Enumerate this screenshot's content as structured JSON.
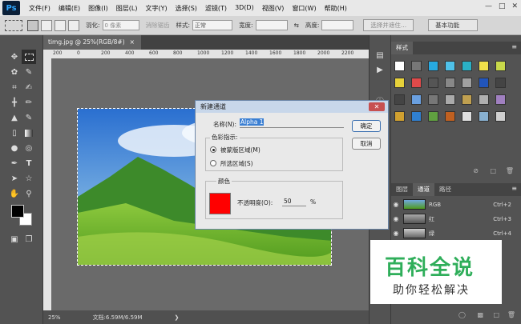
{
  "app": {
    "logo": "Ps"
  },
  "menu": [
    "文件(F)",
    "编辑(E)",
    "图像(I)",
    "图层(L)",
    "文字(Y)",
    "选择(S)",
    "滤镜(T)",
    "3D(D)",
    "视图(V)",
    "窗口(W)",
    "帮助(H)"
  ],
  "options": {
    "feather_label": "羽化:",
    "feather_value": "0 像素",
    "antialias_label": "消除锯齿",
    "style_label": "样式:",
    "style_value": "正常",
    "width_label": "宽度:",
    "height_label": "高度:",
    "select_mask_button": "选择并遮住...",
    "workspace": "基本功能"
  },
  "document": {
    "tab_title": "timg.jpg @ 25%(RGB/8#)",
    "zoom": "25%",
    "doc_size": "文档:6.59M/6.59M"
  },
  "ruler_ticks": [
    "200",
    "0",
    "200",
    "400",
    "600",
    "800",
    "1000",
    "1200",
    "1400",
    "1600",
    "1800",
    "2000",
    "2200"
  ],
  "panels": {
    "styles_tab": "样式",
    "layers_tab": "图层",
    "channels_tab": "通道",
    "paths_tab": "路径",
    "channels": [
      {
        "name": "RGB",
        "shortcut": "Ctrl+2"
      },
      {
        "name": "红",
        "shortcut": "Ctrl+3"
      },
      {
        "name": "绿",
        "shortcut": "Ctrl+4"
      }
    ]
  },
  "dialog": {
    "title": "新建通道",
    "name_label": "名称(N):",
    "name_value": "Alpha 1",
    "color_indicates_label": "色彩指示:",
    "masked_areas": "被蒙版区域(M)",
    "selected_areas": "所选区域(S)",
    "color_group_label": "颜色",
    "opacity_label": "不透明度(O):",
    "opacity_value": "50",
    "opacity_unit": "%",
    "ok_button": "确定",
    "cancel_button": "取消",
    "swatch_color": "#ff0000"
  },
  "watermark": {
    "line1": "百科全说",
    "line2": "助你轻松解决"
  },
  "colors": {
    "accent": "#31a8ff",
    "watermark_green": "#2fae5a"
  }
}
